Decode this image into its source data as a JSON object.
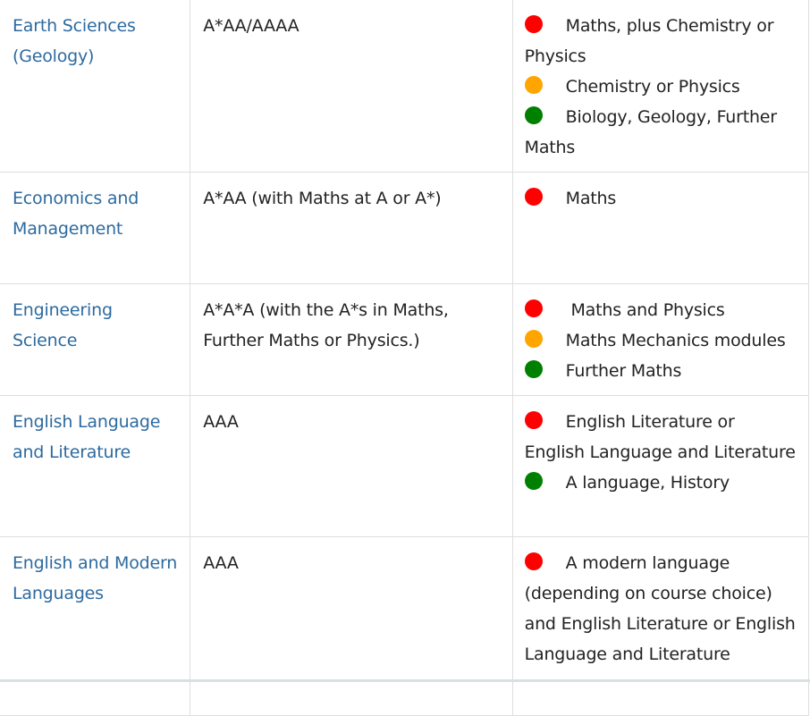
{
  "colors": {
    "essential": "#ff0000",
    "helpful": "#ffa500",
    "useful": "#008000",
    "link": "#2d6a9f"
  },
  "rows": [
    {
      "course": "Earth Sciences (Geology)",
      "grades": "A*AA/AAAA",
      "subjects": [
        {
          "level": "essential",
          "text": "Maths, plus Chemistry or Physics"
        },
        {
          "level": "helpful",
          "text": "Chemistry or Physics"
        },
        {
          "level": "useful",
          "text": "Biology, Geology, Further Maths"
        }
      ]
    },
    {
      "course": "Economics and Management",
      "grades": "A*AA (with Maths at A or A*)",
      "subjects": [
        {
          "level": "essential",
          "text": "Maths"
        }
      ]
    },
    {
      "course": "Engineering Science",
      "grades": "A*A*A (with the A*s in Maths, Further Maths or Physics.)",
      "subjects": [
        {
          "level": "essential",
          "text": " Maths and Physics"
        },
        {
          "level": "helpful",
          "text": "Maths Mechanics modules"
        },
        {
          "level": "useful",
          "text": "Further Maths"
        }
      ]
    },
    {
      "course": "English Language and Literature",
      "grades": "AAA",
      "subjects": [
        {
          "level": "essential",
          "text": "English Literature or English Language and Literature"
        },
        {
          "level": "useful",
          "text": "A language, History"
        }
      ]
    },
    {
      "course": "English and Modern Languages",
      "grades": "AAA",
      "subjects": [
        {
          "level": "essential",
          "text": "A modern language (depending on course choice) and English Literature or English Language and Literature"
        }
      ]
    }
  ]
}
